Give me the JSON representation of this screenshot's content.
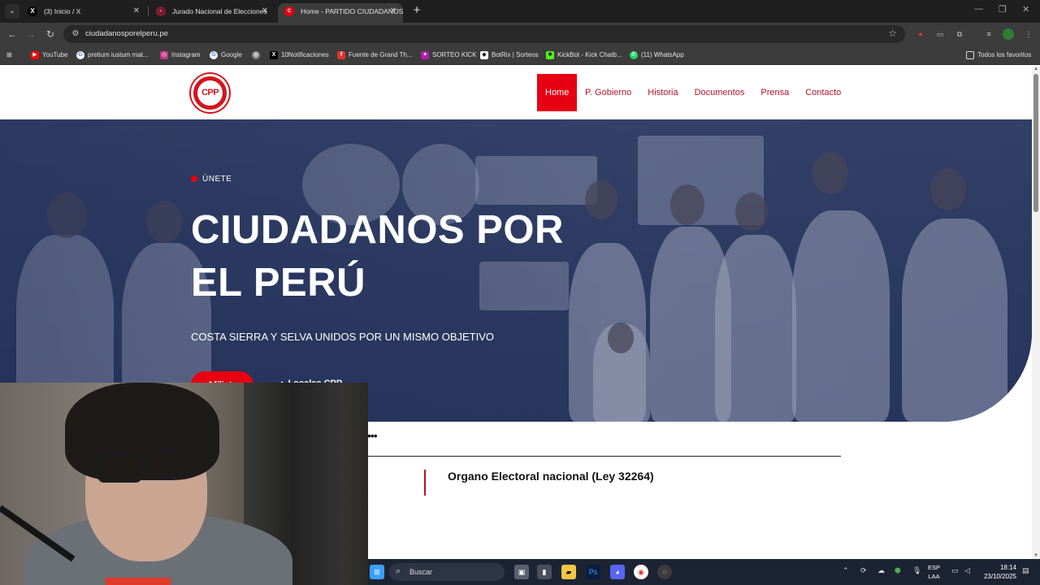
{
  "browser": {
    "tabs": [
      {
        "title": "(3) Inicio / X",
        "icon": "x-logo-icon"
      },
      {
        "title": "Jurado Nacional de Elecciones",
        "icon": "jne-icon"
      },
      {
        "title": "Home - PARTIDO CIUDADANOS",
        "icon": "cpp-icon",
        "active": true
      }
    ],
    "url": "ciudadanosporelperu.pe",
    "bookmarks": [
      {
        "label": "YouTube",
        "icon": "youtube-icon",
        "color": "#ff0000"
      },
      {
        "label": "pretium iustum mat...",
        "icon": "google-icon",
        "color": "#4285f4"
      },
      {
        "label": "Instagram",
        "icon": "instagram-icon",
        "color": "#c13584"
      },
      {
        "label": "Google",
        "icon": "google-icon",
        "color": "#4285f4"
      },
      {
        "label": "",
        "icon": "globe-icon",
        "color": "#888888"
      },
      {
        "label": "10Notificaciones",
        "icon": "x-logo-icon",
        "color": "#000000"
      },
      {
        "label": "Fuente de Grand Th...",
        "icon": "font-icon",
        "color": "#e0352b"
      },
      {
        "label": "SORTEO KICK",
        "icon": "kick-icon",
        "color": "#b01fa8"
      },
      {
        "label": "BotRix | Sorteos",
        "icon": "botrix-icon",
        "color": "#ffffff"
      },
      {
        "label": "KickBot - Kick Chatb...",
        "icon": "kickbot-icon",
        "color": "#53fc18"
      },
      {
        "label": "(11) WhatsApp",
        "icon": "whatsapp-icon",
        "color": "#25d366"
      }
    ],
    "all_bookmarks": "Todos los favoritos"
  },
  "site": {
    "logo_text": "CPP",
    "nav": [
      "Home",
      "P. Gobierno",
      "Historia",
      "Documentos",
      "Prensa",
      "Contacto"
    ],
    "active_nav": "Home",
    "brand_color": "#e60012",
    "hero": {
      "eyebrow": "ÚNETE",
      "title": "CIUDADANOS POR EL PERÚ",
      "subtitle": "COSTA SIERRA Y SELVA UNIDOS POR UN MISMO OBJETIVO",
      "primary_button": "Afíliate",
      "secondary_link": "Locales CPP"
    },
    "section_dots": "•••",
    "org_title": "Organo Electoral nacional (Ley 32264)"
  },
  "taskbar": {
    "search_placeholder": "Buscar",
    "language": "ESP",
    "layout": "LAA",
    "time": "18:14",
    "date": "23/10/2025"
  }
}
